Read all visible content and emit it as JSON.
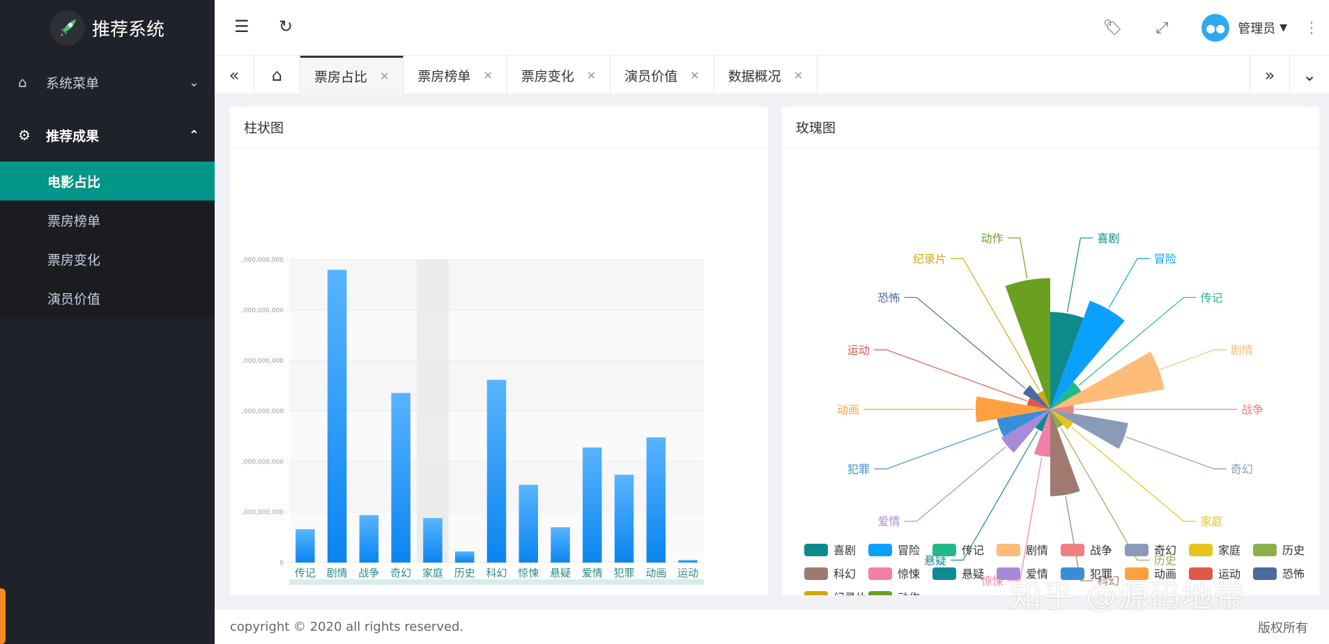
{
  "app": {
    "title": "推荐系统"
  },
  "sidebar": {
    "groups": [
      {
        "label": "系统菜单",
        "icon": "home-icon",
        "expanded": false
      },
      {
        "label": "推荐成果",
        "icon": "gear-icon",
        "expanded": true,
        "items": [
          {
            "label": "电影占比",
            "active": true
          },
          {
            "label": "票房榜单"
          },
          {
            "label": "票房变化"
          },
          {
            "label": "演员价值"
          }
        ]
      }
    ]
  },
  "header": {
    "user": "管理员"
  },
  "tabs": [
    {
      "label": "票房占比",
      "active": true
    },
    {
      "label": "票房榜单"
    },
    {
      "label": "票房变化"
    },
    {
      "label": "演员价值"
    },
    {
      "label": "数据概况"
    }
  ],
  "cards": {
    "bar_title": "柱状图",
    "rose_title": "玫瑰图"
  },
  "footer": {
    "copyright": "copyright © 2020 all rights reserved.",
    "rights": "版权所有"
  },
  "watermark": "知乎 @源码地带",
  "colors": {
    "accent": "#009688",
    "sidebar": "#20222a",
    "bar": "#1e90ff"
  },
  "chart_data": [
    {
      "type": "bar",
      "title": "柱状图",
      "categories": [
        "传记",
        "剧情",
        "战争",
        "奇幻",
        "家庭",
        "历史",
        "科幻",
        "惊悚",
        "悬疑",
        "爱情",
        "犯罪",
        "动画",
        "运动"
      ],
      "values": [
        3300000000,
        29000000000,
        4700000000,
        16800000000,
        4400000000,
        1100000000,
        18100000000,
        7700000000,
        3500000000,
        11400000000,
        8700000000,
        12400000000,
        250000000
      ],
      "ylim": [
        0,
        30000000000
      ],
      "yticks": [
        "0",
        ",000,000,000",
        ",000,000,000",
        ",000,000,000",
        ",000,000,000",
        ",000,000,000",
        ",000,000,000"
      ],
      "highlight_index": 4,
      "grid": true
    },
    {
      "type": "pie",
      "rose": true,
      "title": "玫瑰图",
      "legend_position": "bottom",
      "categories": [
        "喜剧",
        "冒险",
        "传记",
        "剧情",
        "战争",
        "奇幻",
        "家庭",
        "历史",
        "科幻",
        "惊悚",
        "悬疑",
        "爱情",
        "犯罪",
        "动画",
        "运动",
        "恐怖",
        "纪录片",
        "动作"
      ],
      "values": [
        70,
        100,
        8,
        100,
        3,
        45,
        4,
        2,
        55,
        15,
        3,
        22,
        20,
        40,
        3,
        6,
        2,
        130
      ],
      "colors": [
        "#0e8a8a",
        "#0aa0ff",
        "#22b98a",
        "#ffbb78",
        "#f08080",
        "#8a9bb8",
        "#e8c41a",
        "#8ab04a",
        "#a07a6e",
        "#f27fa8",
        "#0e8a96",
        "#a78ad8",
        "#3a8ed8",
        "#ffa040",
        "#e0584a",
        "#4a6aa0",
        "#d4a80a",
        "#6aa020"
      ]
    }
  ]
}
